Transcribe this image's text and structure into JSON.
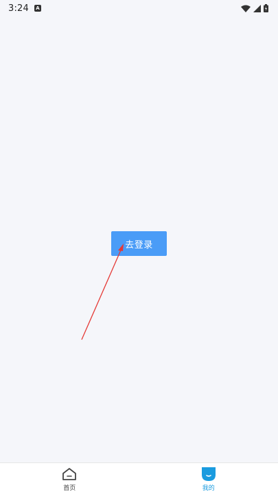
{
  "status_bar": {
    "time": "3:24",
    "notification_glyph": "A",
    "icons": [
      "wifi-icon",
      "cellular-signal-icon",
      "battery-icon"
    ]
  },
  "main": {
    "login_button_label": "去登录"
  },
  "bottom_nav": {
    "items": [
      {
        "label": "首页",
        "icon": "home-icon",
        "active": false
      },
      {
        "label": "我的",
        "icon": "profile-icon",
        "active": true
      }
    ]
  },
  "colors": {
    "background": "#f5f6fa",
    "button": "#4a9cf7",
    "active_tab": "#1a9bdf",
    "annotation": "#e53935"
  }
}
